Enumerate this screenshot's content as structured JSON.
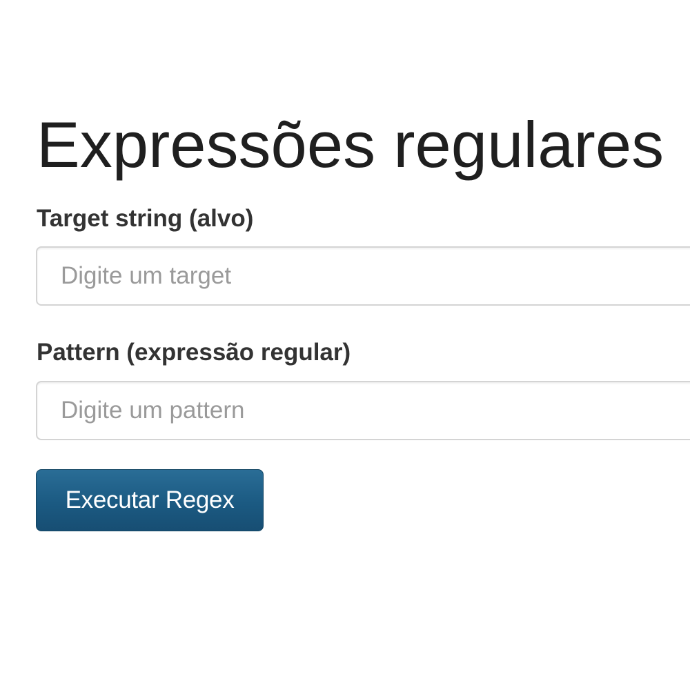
{
  "page": {
    "title": "Expressões regulares"
  },
  "form": {
    "target": {
      "label": "Target string (alvo)",
      "placeholder": "Digite um target",
      "value": ""
    },
    "pattern": {
      "label": "Pattern (expressão regular)",
      "placeholder": "Digite um pattern",
      "value": ""
    },
    "submit_label": "Executar Regex"
  },
  "colors": {
    "button_background": "#1b5a82",
    "button_text": "#ffffff",
    "field_border": "#d4d4d4",
    "placeholder_text": "#9a9a9a"
  }
}
